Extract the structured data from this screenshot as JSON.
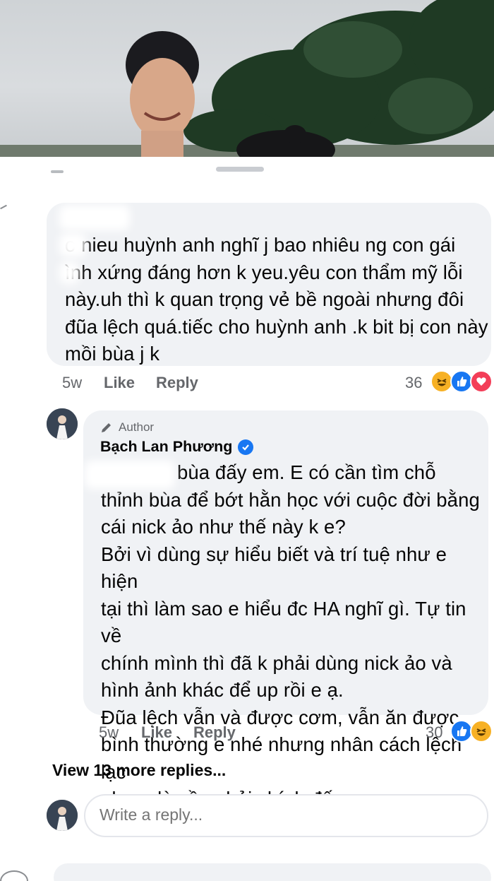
{
  "comment_1": {
    "text": "o nieu huỳnh anh nghĩ j bao nhiêu ng con gái\n ình xứng đáng hơn k yeu.yêu con thẩm mỹ lỗi\nnày.uh thì k quan trọng vẻ bề ngoài nhưng đôi\nđũa lệch quá.tiếc cho huỳnh anh .k bit bị con này\nmồi bùa j k",
    "time": "5w",
    "like_label": "Like",
    "reply_label": "Reply",
    "reaction_count": "36",
    "reactions": [
      "haha-icon",
      "like-icon",
      "love-icon"
    ]
  },
  "comment_2": {
    "badge": "Author",
    "author": "Bạch Lan Phương",
    "text": "bùa đấy em. E có cần tìm chỗ\nthỉnh bùa để bớt hằn học với cuộc đời bằng\ncái nick ảo như thế này k e?\nBởi vì dùng sự hiểu biết và trí tuệ như e hiện\ntại thì làm sao e hiểu đc HA nghĩ gì. Tự tin về\nchính mình thì đã k phải dùng nick ảo và\nhình ảnh khác để up rồi e ạ.\nĐũa lệch vẫn và được cơm, vẫn ăn được\nbình thường e nhé nhưng nhân cách lệch lạc\nnhư e là cần phải chính đấy e.",
    "time": "5w",
    "like_label": "Like",
    "reply_label": "Reply",
    "reaction_count": "30",
    "reactions": [
      "like-icon",
      "haha-icon"
    ]
  },
  "view_more": "View 13 more replies...",
  "reply_input": {
    "placeholder": "Write a reply..."
  },
  "colors": {
    "bubble": "#f0f2f5",
    "meta": "#65676b",
    "like_blue": "#1877f2",
    "love_red": "#f33e58",
    "haha_yellow": "#f7b125"
  }
}
